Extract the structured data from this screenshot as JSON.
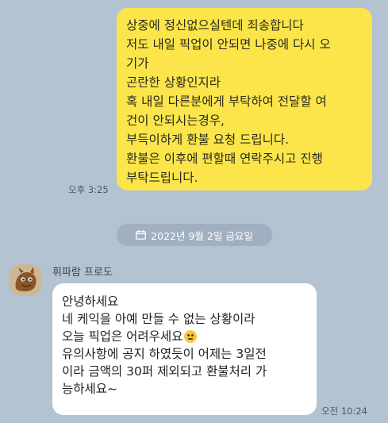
{
  "outgoing": {
    "lines": [
      "상중에 정신없으실텐데 죄송합니다",
      "저도 내일 픽업이 안되면 나중에 다시 오",
      "기가",
      "곤란한 상황인지라",
      "혹 내일 다른분에게 부탁하여 전달할 여",
      "건이 안되시는경우,",
      "부득이하게 환불 요청 드립니다.",
      "환불은 이후에 편할때 연락주시고 진행",
      "부탁드립니다."
    ],
    "time": "오후 3:25"
  },
  "date_divider": {
    "text": "2022년 9월 2일 금요일",
    "icon": "calendar-icon"
  },
  "incoming": {
    "sender": "휘파람 프로도",
    "avatar_icon": "character-avatar",
    "lines": [
      "안녕하세요",
      "네 케익을 아예 만들 수 없는 상황이라",
      "오늘 픽업은 어려우세요",
      "유의사항에 공지 하였듯이 어제는 3일전",
      "이라 금액의 30퍼 제외되고 환불처리 가",
      "능하세요~"
    ],
    "emoji_icon": "sad-face-emoji",
    "time": "오전 10:24"
  },
  "colors": {
    "background": "#b4c3d2",
    "outgoing_bubble": "#fce54a",
    "incoming_bubble": "#ffffff"
  }
}
